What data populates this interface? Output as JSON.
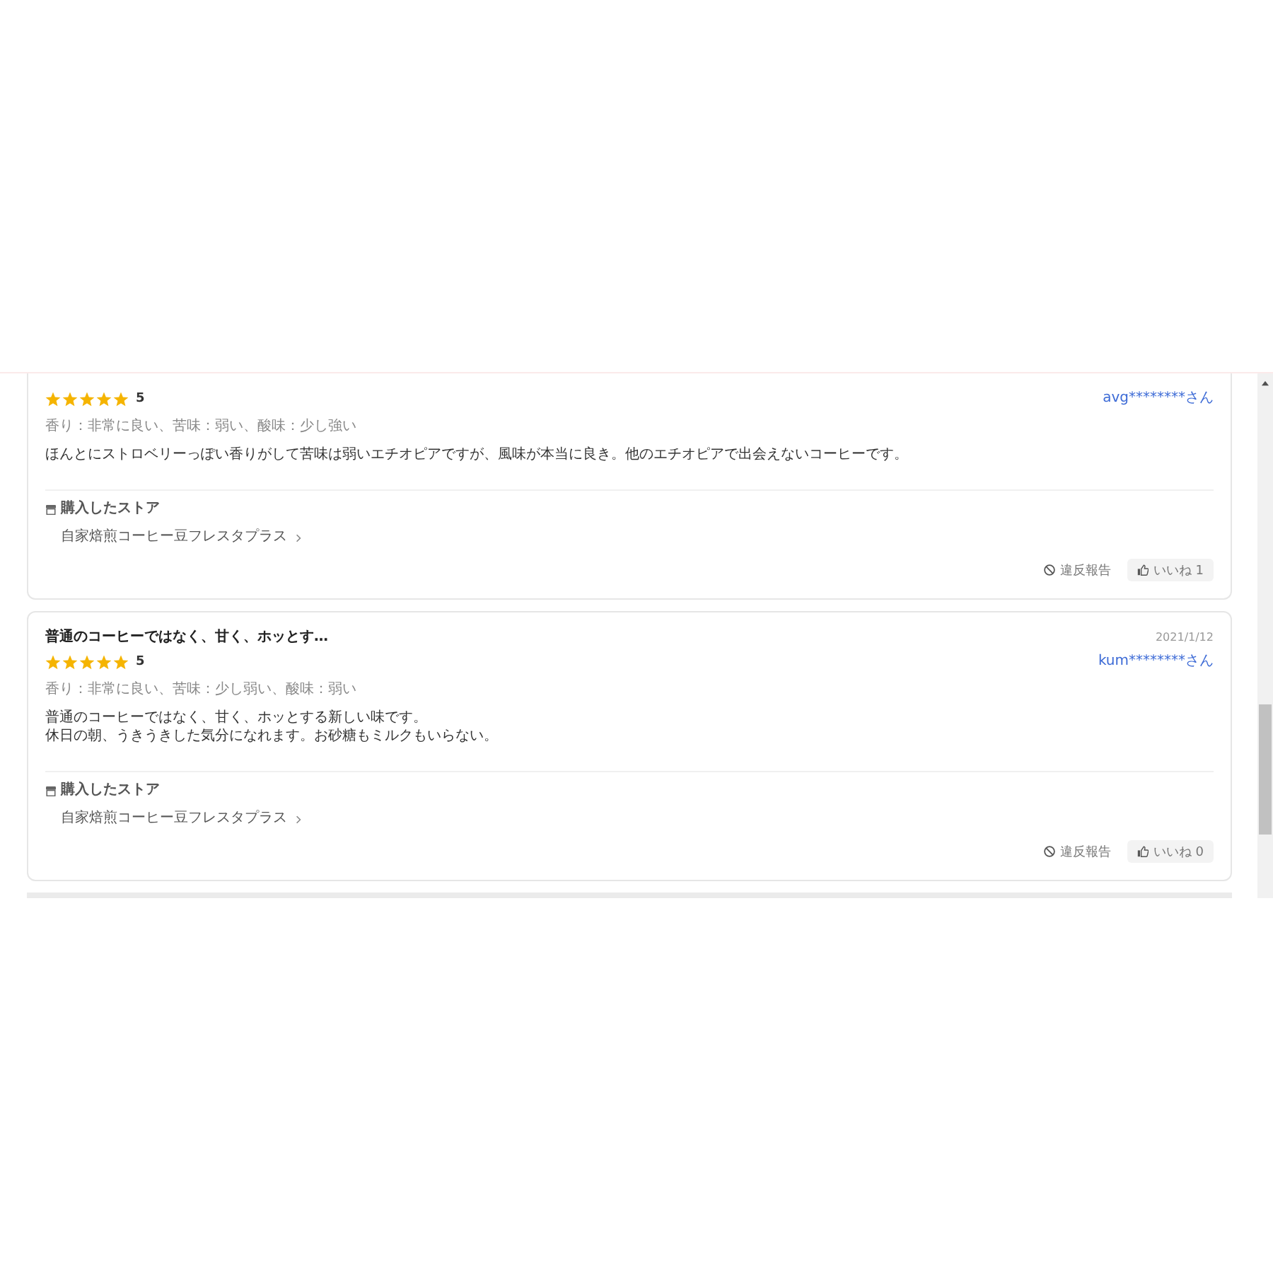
{
  "reviews": [
    {
      "stars": 5,
      "rating_text": "5",
      "user": "avg********さん",
      "attributes": "香り：非常に良い、苦味：弱い、酸味：少し強い",
      "body_lines": [
        "ほんとにストロベリーっぽい香りがして苦味は弱いエチオピアですが、風味が本当に良き。他のエチオピアで出会えないコーヒーです。"
      ],
      "store_label": "購入したストア",
      "store_name": "自家焙煎コーヒー豆フレスタプラス",
      "report_label": "違反報告",
      "like_label": "いいね 1"
    },
    {
      "title": "普通のコーヒーではなく、甘く、ホッとす…",
      "date": "2021/1/12",
      "stars": 5,
      "rating_text": "5",
      "user": "kum********さん",
      "attributes": "香り：非常に良い、苦味：少し弱い、酸味：弱い",
      "body_lines": [
        "普通のコーヒーではなく、甘く、ホッとする新しい味です。",
        "休日の朝、うきうきした気分になれます。お砂糖もミルクもいらない。"
      ],
      "store_label": "購入したストア",
      "store_name": "自家焙煎コーヒー豆フレスタプラス",
      "report_label": "違反報告",
      "like_label": "いいね 0"
    }
  ]
}
